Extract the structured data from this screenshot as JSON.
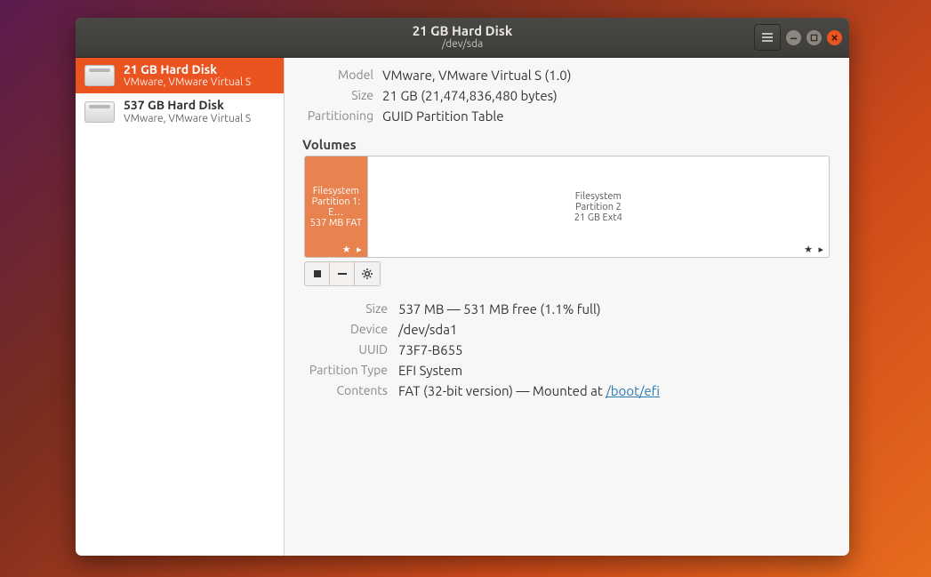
{
  "titlebar": {
    "title": "21 GB Hard Disk",
    "subtitle": "/dev/sda"
  },
  "sidebar": {
    "items": [
      {
        "title": "21 GB Hard Disk",
        "subtitle": "VMware, VMware Virtual S",
        "selected": true
      },
      {
        "title": "537 GB Hard Disk",
        "subtitle": "VMware, VMware Virtual S",
        "selected": false
      }
    ]
  },
  "disk": {
    "model_label": "Model",
    "model": "VMware, VMware Virtual S (1.0)",
    "size_label": "Size",
    "size": "21 GB (21,474,836,480 bytes)",
    "part_label": "Partitioning",
    "partitioning": "GUID Partition Table"
  },
  "volumes_heading": "Volumes",
  "volumes": [
    {
      "line1": "Filesystem",
      "line2": "Partition 1: E…",
      "line3": "537 MB FAT",
      "width_pct": 12,
      "selected": true,
      "indicators": "★ ▸"
    },
    {
      "line1": "Filesystem",
      "line2": "Partition 2",
      "line3": "21 GB Ext4",
      "width_pct": 88,
      "selected": false,
      "indicators": "★ ▸"
    }
  ],
  "vol_toolbar": {
    "unmount": "Unmount",
    "delete": "Delete",
    "settings": "Settings"
  },
  "partition": {
    "size_label": "Size",
    "size": "537 MB — 531 MB free (1.1% full)",
    "dev_label": "Device",
    "device": "/dev/sda1",
    "uuid_label": "UUID",
    "uuid": "73F7-B655",
    "ptype_label": "Partition Type",
    "ptype": "EFI System",
    "contents_label": "Contents",
    "contents_pre": "FAT (32-bit version) — Mounted at ",
    "contents_link": "/boot/efi"
  }
}
